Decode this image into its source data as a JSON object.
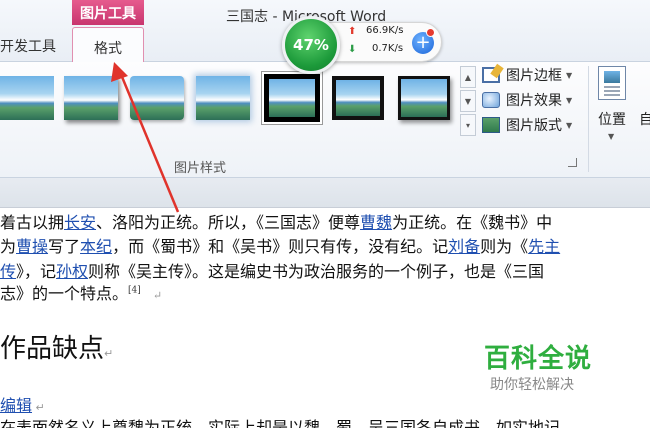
{
  "window": {
    "title": "三国志 - Microsoft Word"
  },
  "tabs": {
    "context_group": "图片工具",
    "developer": "开发工具",
    "format": "格式"
  },
  "ribbon": {
    "picture_border": "图片边框",
    "picture_effects": "图片效果",
    "picture_layout": "图片版式",
    "position": "位置",
    "auto_wrap_partial": "自",
    "group_label": "图片样式"
  },
  "speed_widget": {
    "percent": "47%",
    "upload": "66.9K/s",
    "download": "0.7K/s"
  },
  "document": {
    "line1": [
      {
        "t": "着古以拥"
      },
      {
        "t": "长安",
        "link": true
      },
      {
        "t": "、洛阳为正统。所以，《三国志》便尊"
      },
      {
        "t": "曹魏",
        "link": true
      },
      {
        "t": "为正统。在《魏书》中"
      }
    ],
    "line2": [
      {
        "t": "为"
      },
      {
        "t": "曹操",
        "link": true
      },
      {
        "t": "写了"
      },
      {
        "t": "本纪",
        "link": true
      },
      {
        "t": "，而《蜀书》和《吴书》则只有传，没有纪。记"
      },
      {
        "t": "刘备",
        "link": true
      },
      {
        "t": "则为《"
      },
      {
        "t": "先主",
        "link": true
      }
    ],
    "line3": [
      {
        "t": "传",
        "link": true
      },
      {
        "t": "》，记"
      },
      {
        "t": "孙权",
        "link": true
      },
      {
        "t": "则称《吴主传》。这是编史书为政治服务的一个例子，也是《三国"
      }
    ],
    "line4": "志》的一个特点。",
    "footnote": "[4]",
    "heading": "作品缺点",
    "edit_link": "编辑",
    "line6": "在表面然名义上尊魏为正统，实际上却是以魏、蜀、吴三国各自成书，如实地记"
  },
  "watermark": {
    "title": "百科全说",
    "subtitle": "助你轻松解决"
  }
}
